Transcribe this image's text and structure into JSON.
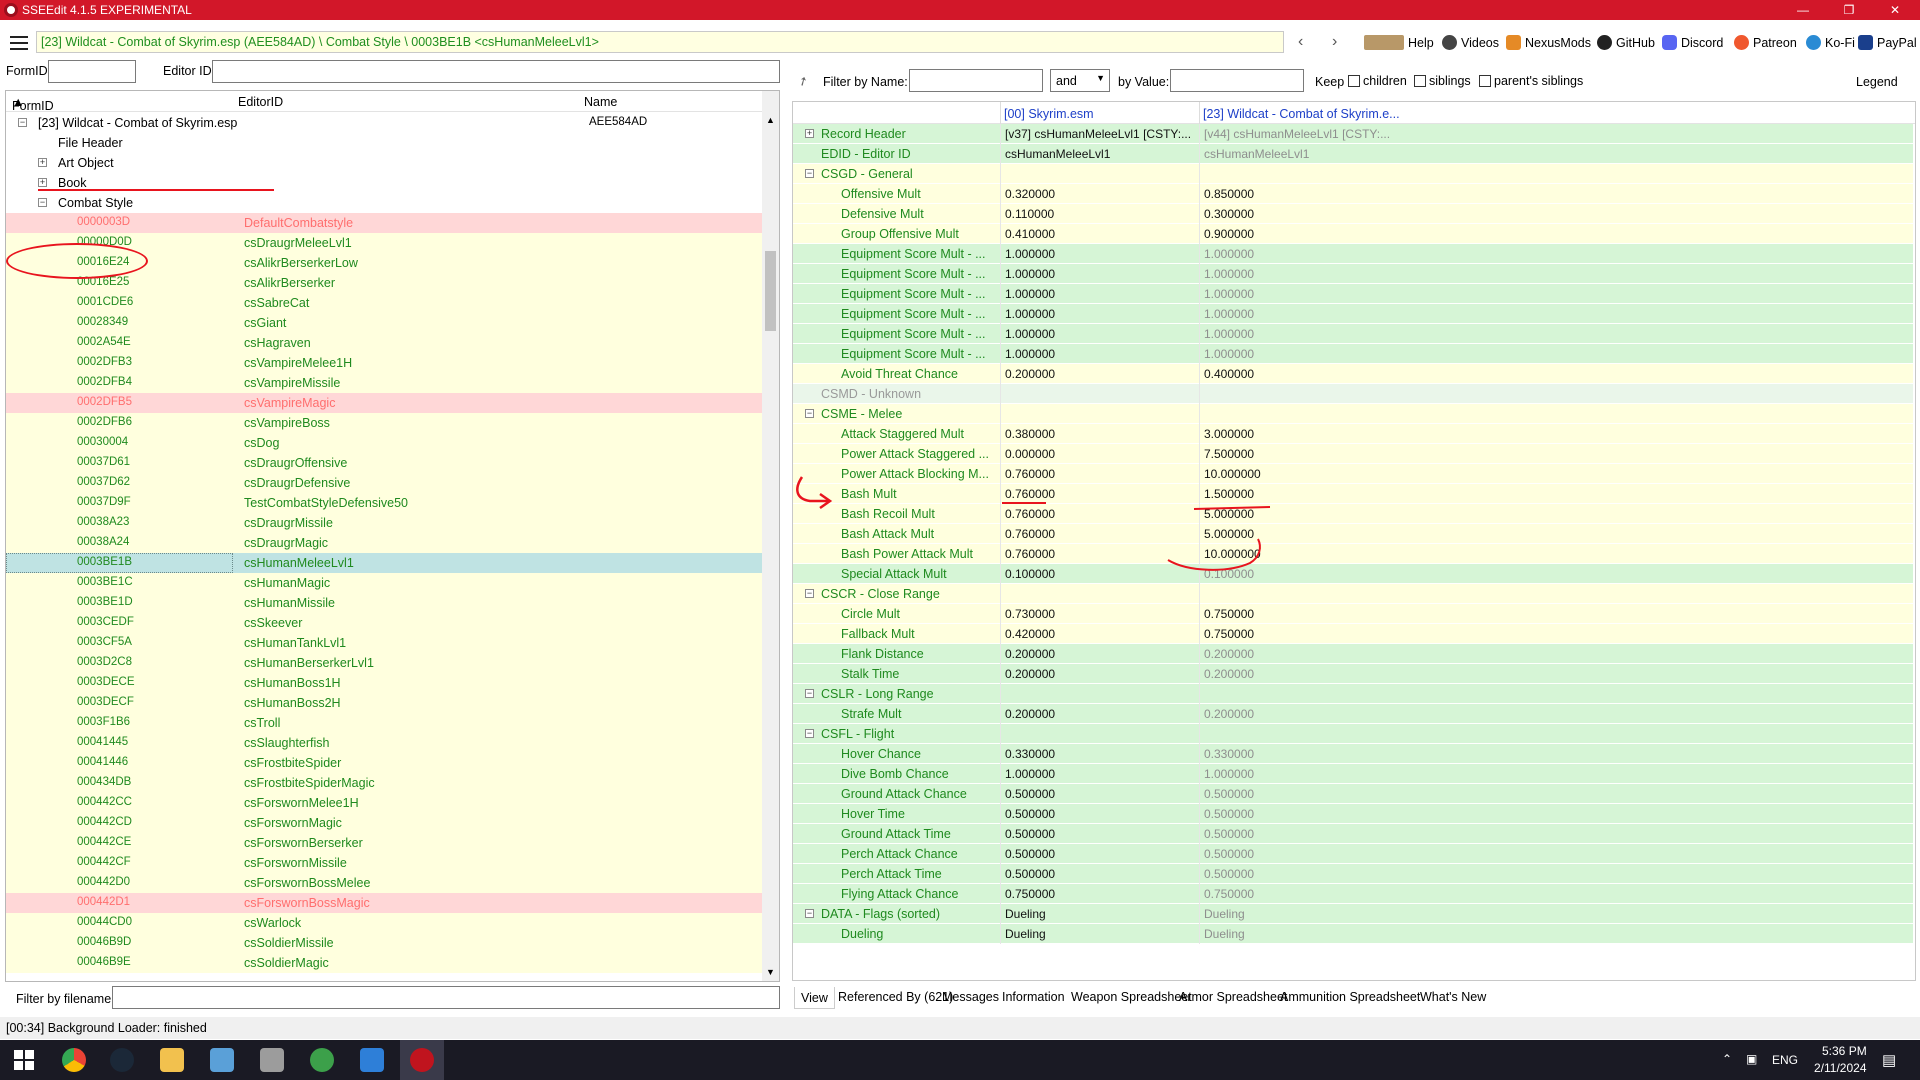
{
  "window": {
    "title": "SSEEdit 4.1.5 EXPERIMENTAL"
  },
  "toolbar": {
    "path": "[23] Wildcat - Combat of Skyrim.esp (AEE584AD) \\ Combat Style \\ 0003BE1B <csHumanMeleeLvl1>",
    "links": [
      "Help",
      "Videos",
      "NexusMods",
      "GitHub",
      "Discord",
      "Patreon",
      "Ko-Fi",
      "PayPal"
    ]
  },
  "left": {
    "formid_label": "FormID",
    "editorid_label": "Editor ID",
    "columns": [
      "FormID",
      "EditorID",
      "Name"
    ],
    "plugin": {
      "name": "[23] Wildcat - Combat of Skyrim.esp",
      "id": "AEE584AD"
    },
    "groups": [
      "File Header",
      "Art Object",
      "Book",
      "Combat Style"
    ],
    "records": [
      {
        "id": "0000003D",
        "eid": "DefaultCombatstyle",
        "style": "red"
      },
      {
        "id": "00000D0D",
        "eid": "csDraugrMeleeLvl1",
        "style": ""
      },
      {
        "id": "00016E24",
        "eid": "csAlikrBerserkerLow",
        "style": ""
      },
      {
        "id": "00016E25",
        "eid": "csAlikrBerserker",
        "style": ""
      },
      {
        "id": "0001CDE6",
        "eid": "csSabreCat",
        "style": ""
      },
      {
        "id": "00028349",
        "eid": "csGiant",
        "style": ""
      },
      {
        "id": "0002A54E",
        "eid": "csHagraven",
        "style": ""
      },
      {
        "id": "0002DFB3",
        "eid": "csVampireMelee1H",
        "style": ""
      },
      {
        "id": "0002DFB4",
        "eid": "csVampireMissile",
        "style": ""
      },
      {
        "id": "0002DFB5",
        "eid": "csVampireMagic",
        "style": "red"
      },
      {
        "id": "0002DFB6",
        "eid": "csVampireBoss",
        "style": ""
      },
      {
        "id": "00030004",
        "eid": "csDog",
        "style": ""
      },
      {
        "id": "00037D61",
        "eid": "csDraugrOffensive",
        "style": ""
      },
      {
        "id": "00037D62",
        "eid": "csDraugrDefensive",
        "style": ""
      },
      {
        "id": "00037D9F",
        "eid": "TestCombatStyleDefensive50",
        "style": ""
      },
      {
        "id": "00038A23",
        "eid": "csDraugrMissile",
        "style": ""
      },
      {
        "id": "00038A24",
        "eid": "csDraugrMagic",
        "style": ""
      },
      {
        "id": "0003BE1B",
        "eid": "csHumanMeleeLvl1",
        "style": "sel"
      },
      {
        "id": "0003BE1C",
        "eid": "csHumanMagic",
        "style": ""
      },
      {
        "id": "0003BE1D",
        "eid": "csHumanMissile",
        "style": ""
      },
      {
        "id": "0003CEDF",
        "eid": "csSkeever",
        "style": ""
      },
      {
        "id": "0003CF5A",
        "eid": "csHumanTankLvl1",
        "style": ""
      },
      {
        "id": "0003D2C8",
        "eid": "csHumanBerserkerLvl1",
        "style": ""
      },
      {
        "id": "0003DECE",
        "eid": "csHumanBoss1H",
        "style": ""
      },
      {
        "id": "0003DECF",
        "eid": "csHumanBoss2H",
        "style": ""
      },
      {
        "id": "0003F1B6",
        "eid": "csTroll",
        "style": ""
      },
      {
        "id": "00041445",
        "eid": "csSlaughterfish",
        "style": ""
      },
      {
        "id": "00041446",
        "eid": "csFrostbiteSpider",
        "style": ""
      },
      {
        "id": "000434DB",
        "eid": "csFrostbiteSpiderMagic",
        "style": ""
      },
      {
        "id": "000442CC",
        "eid": "csForswornMelee1H",
        "style": ""
      },
      {
        "id": "000442CD",
        "eid": "csForswornMagic",
        "style": ""
      },
      {
        "id": "000442CE",
        "eid": "csForswornBerserker",
        "style": ""
      },
      {
        "id": "000442CF",
        "eid": "csForswornMissile",
        "style": ""
      },
      {
        "id": "000442D0",
        "eid": "csForswornBossMelee",
        "style": ""
      },
      {
        "id": "000442D1",
        "eid": "csForswornBossMagic",
        "style": "red"
      },
      {
        "id": "00044CD0",
        "eid": "csWarlock",
        "style": ""
      },
      {
        "id": "00046B9D",
        "eid": "csSoldierMissile",
        "style": ""
      },
      {
        "id": "00046B9E",
        "eid": "csSoldierMagic",
        "style": ""
      }
    ],
    "filter_label": "Filter by filename:"
  },
  "right": {
    "filter_name_label": "Filter by Name:",
    "and_value": "and",
    "by_value_label": "by Value:",
    "keep_label": "Keep",
    "checks": [
      "children",
      "siblings",
      "parent's siblings"
    ],
    "legend": "Legend",
    "col1": "[00] Skyrim.esm",
    "col2": "[23] Wildcat - Combat of Skyrim.e...",
    "rows": [
      {
        "label": "Record Header",
        "a": "[v37] csHumanMeleeLvl1 [CSTY:...",
        "b": "[v44] csHumanMeleeLvl1 [CSTY:...",
        "indent": 1,
        "bg": "g",
        "exp": "+"
      },
      {
        "label": "EDID - Editor ID",
        "a": "csHumanMeleeLvl1",
        "b": "csHumanMeleeLvl1",
        "indent": 1,
        "bg": "g",
        "exp": ""
      },
      {
        "label": "CSGD - General",
        "a": "",
        "b": "",
        "indent": 1,
        "bg": "y",
        "exp": "-"
      },
      {
        "label": "Offensive Mult",
        "a": "0.320000",
        "b": "0.850000",
        "indent": 2,
        "bg": "y",
        "exp": ""
      },
      {
        "label": "Defensive Mult",
        "a": "0.110000",
        "b": "0.300000",
        "indent": 2,
        "bg": "y",
        "exp": ""
      },
      {
        "label": "Group Offensive Mult",
        "a": "0.410000",
        "b": "0.900000",
        "indent": 2,
        "bg": "y",
        "exp": ""
      },
      {
        "label": "Equipment Score Mult - ...",
        "a": "1.000000",
        "b": "1.000000",
        "indent": 2,
        "bg": "g",
        "exp": ""
      },
      {
        "label": "Equipment Score Mult - ...",
        "a": "1.000000",
        "b": "1.000000",
        "indent": 2,
        "bg": "g",
        "exp": ""
      },
      {
        "label": "Equipment Score Mult - ...",
        "a": "1.000000",
        "b": "1.000000",
        "indent": 2,
        "bg": "g",
        "exp": ""
      },
      {
        "label": "Equipment Score Mult - ...",
        "a": "1.000000",
        "b": "1.000000",
        "indent": 2,
        "bg": "g",
        "exp": ""
      },
      {
        "label": "Equipment Score Mult - ...",
        "a": "1.000000",
        "b": "1.000000",
        "indent": 2,
        "bg": "g",
        "exp": ""
      },
      {
        "label": "Equipment Score Mult - ...",
        "a": "1.000000",
        "b": "1.000000",
        "indent": 2,
        "bg": "g",
        "exp": ""
      },
      {
        "label": "Avoid Threat Chance",
        "a": "0.200000",
        "b": "0.400000",
        "indent": 2,
        "bg": "y",
        "exp": ""
      },
      {
        "label": "CSMD - Unknown",
        "a": "",
        "b": "",
        "indent": 1,
        "bg": "gr",
        "exp": "",
        "dim": true
      },
      {
        "label": "CSME - Melee",
        "a": "",
        "b": "",
        "indent": 1,
        "bg": "y",
        "exp": "-"
      },
      {
        "label": "Attack Staggered Mult",
        "a": "0.380000",
        "b": "3.000000",
        "indent": 2,
        "bg": "y",
        "exp": ""
      },
      {
        "label": "Power Attack Staggered ...",
        "a": "0.000000",
        "b": "7.500000",
        "indent": 2,
        "bg": "y",
        "exp": ""
      },
      {
        "label": "Power Attack Blocking M...",
        "a": "0.760000",
        "b": "10.000000",
        "indent": 2,
        "bg": "y",
        "exp": ""
      },
      {
        "label": "Bash Mult",
        "a": "0.760000",
        "b": "1.500000",
        "indent": 2,
        "bg": "y",
        "exp": ""
      },
      {
        "label": "Bash Recoil Mult",
        "a": "0.760000",
        "b": "5.000000",
        "indent": 2,
        "bg": "y",
        "exp": ""
      },
      {
        "label": "Bash Attack Mult",
        "a": "0.760000",
        "b": "5.000000",
        "indent": 2,
        "bg": "y",
        "exp": ""
      },
      {
        "label": "Bash Power Attack Mult",
        "a": "0.760000",
        "b": "10.000000",
        "indent": 2,
        "bg": "y",
        "exp": ""
      },
      {
        "label": "Special Attack Mult",
        "a": "0.100000",
        "b": "0.100000",
        "indent": 2,
        "bg": "g",
        "exp": ""
      },
      {
        "label": "CSCR - Close Range",
        "a": "",
        "b": "",
        "indent": 1,
        "bg": "y",
        "exp": "-"
      },
      {
        "label": "Circle Mult",
        "a": "0.730000",
        "b": "0.750000",
        "indent": 2,
        "bg": "y",
        "exp": ""
      },
      {
        "label": "Fallback Mult",
        "a": "0.420000",
        "b": "0.750000",
        "indent": 2,
        "bg": "y",
        "exp": ""
      },
      {
        "label": "Flank Distance",
        "a": "0.200000",
        "b": "0.200000",
        "indent": 2,
        "bg": "g",
        "exp": ""
      },
      {
        "label": "Stalk Time",
        "a": "0.200000",
        "b": "0.200000",
        "indent": 2,
        "bg": "g",
        "exp": ""
      },
      {
        "label": "CSLR - Long Range",
        "a": "",
        "b": "",
        "indent": 1,
        "bg": "g",
        "exp": "-"
      },
      {
        "label": "Strafe Mult",
        "a": "0.200000",
        "b": "0.200000",
        "indent": 2,
        "bg": "g",
        "exp": ""
      },
      {
        "label": "CSFL - Flight",
        "a": "",
        "b": "",
        "indent": 1,
        "bg": "g",
        "exp": "-"
      },
      {
        "label": "Hover Chance",
        "a": "0.330000",
        "b": "0.330000",
        "indent": 2,
        "bg": "g",
        "exp": ""
      },
      {
        "label": "Dive Bomb Chance",
        "a": "1.000000",
        "b": "1.000000",
        "indent": 2,
        "bg": "g",
        "exp": ""
      },
      {
        "label": "Ground Attack Chance",
        "a": "0.500000",
        "b": "0.500000",
        "indent": 2,
        "bg": "g",
        "exp": ""
      },
      {
        "label": "Hover Time",
        "a": "0.500000",
        "b": "0.500000",
        "indent": 2,
        "bg": "g",
        "exp": ""
      },
      {
        "label": "Ground Attack Time",
        "a": "0.500000",
        "b": "0.500000",
        "indent": 2,
        "bg": "g",
        "exp": ""
      },
      {
        "label": "Perch Attack Chance",
        "a": "0.500000",
        "b": "0.500000",
        "indent": 2,
        "bg": "g",
        "exp": ""
      },
      {
        "label": "Perch Attack Time",
        "a": "0.500000",
        "b": "0.500000",
        "indent": 2,
        "bg": "g",
        "exp": ""
      },
      {
        "label": "Flying Attack Chance",
        "a": "0.750000",
        "b": "0.750000",
        "indent": 2,
        "bg": "g",
        "exp": ""
      },
      {
        "label": "DATA - Flags (sorted)",
        "a": "Dueling",
        "b": "Dueling",
        "indent": 1,
        "bg": "g",
        "exp": "-"
      },
      {
        "label": "Dueling",
        "a": "Dueling",
        "b": "Dueling",
        "indent": 2,
        "bg": "g",
        "exp": ""
      }
    ],
    "tabs": [
      "View",
      "Referenced By (621)",
      "Messages",
      "Information",
      "Weapon Spreadsheet",
      "Armor Spreadsheet",
      "Ammunition Spreadsheet",
      "What's New"
    ]
  },
  "status": {
    "text": "[00:34] Background Loader: finished"
  },
  "taskbar": {
    "lang": "ENG",
    "time": "5:36 PM",
    "date": "2/11/2024"
  }
}
